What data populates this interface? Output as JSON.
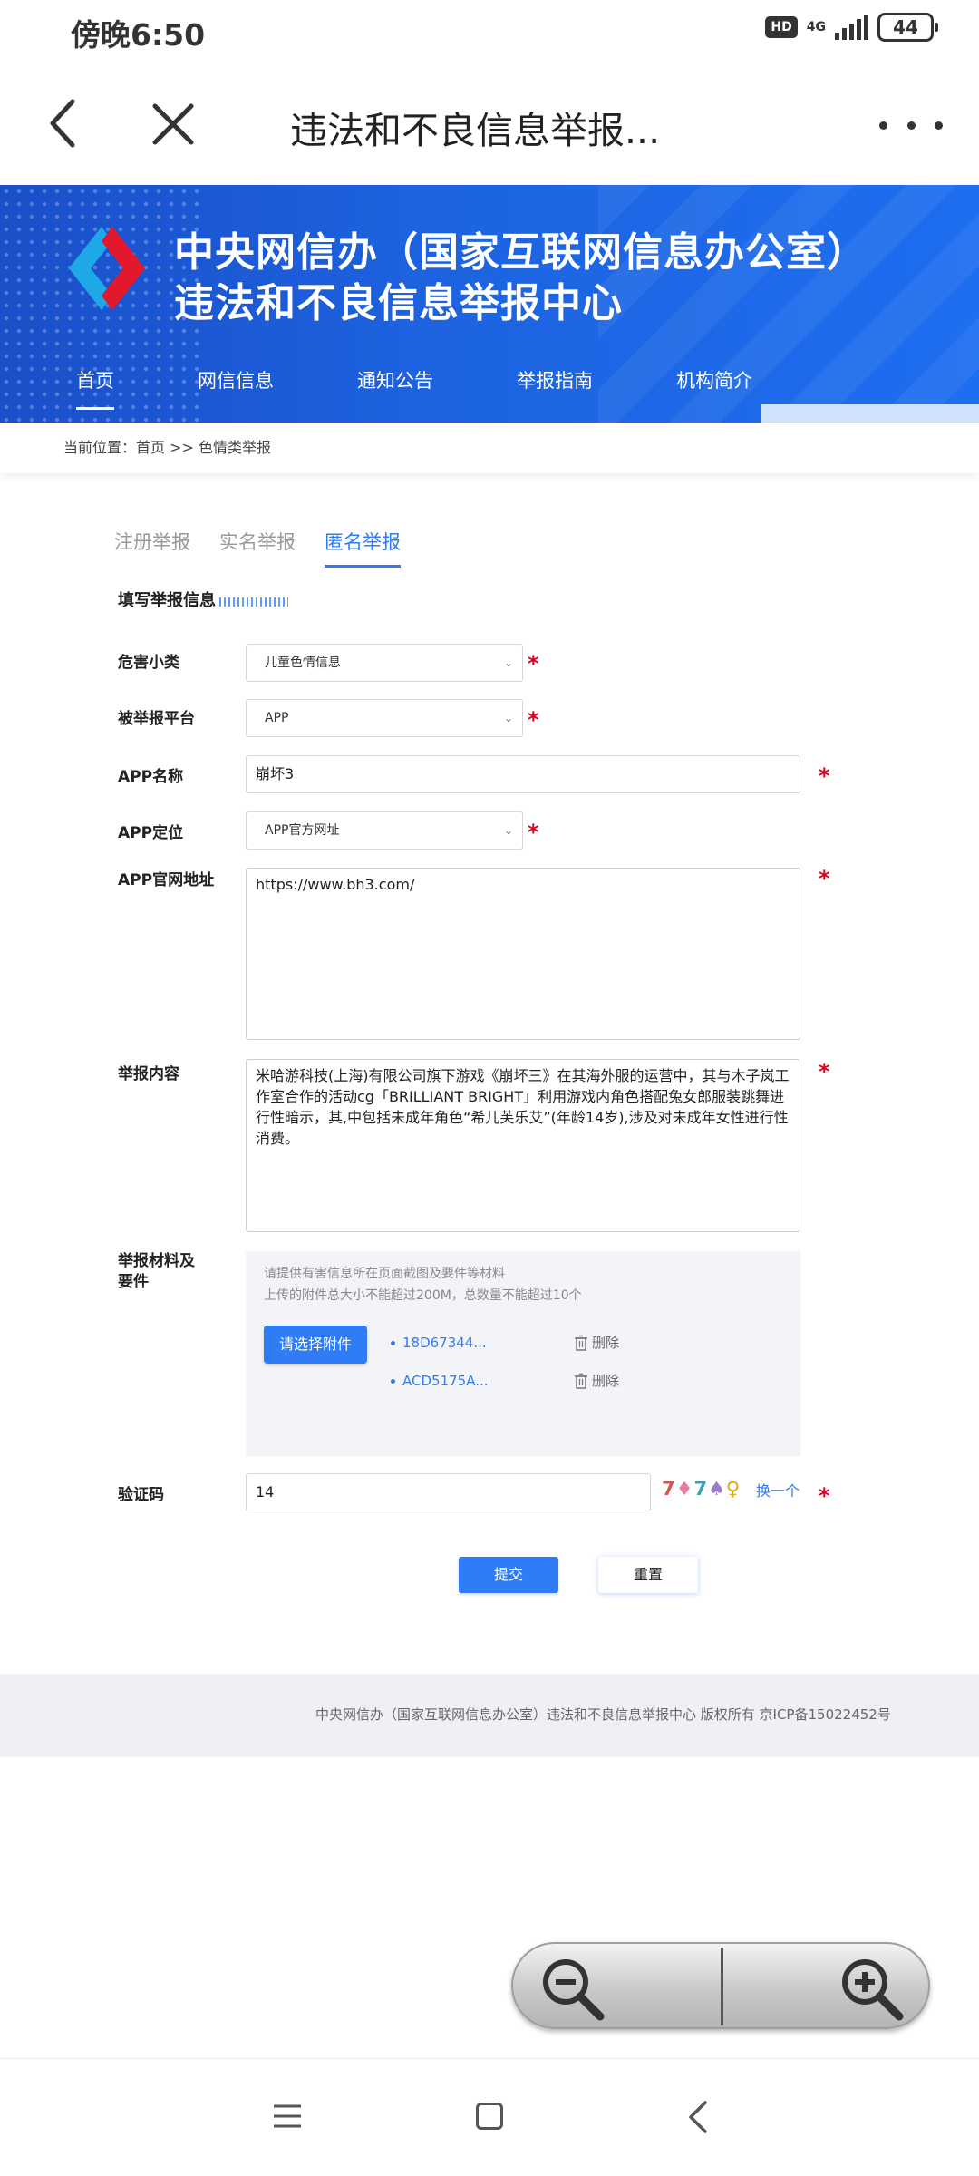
{
  "status": {
    "time": "傍晚6:50",
    "hd": "HD",
    "network": "4G",
    "battery": "44"
  },
  "header": {
    "title": "违法和不良信息举报..."
  },
  "banner": {
    "title_line1": "中央网信办（国家互联网信息办公室）",
    "title_line2": "违法和不良信息举报中心",
    "nav": [
      "首页",
      "网信信息",
      "通知公告",
      "举报指南",
      "机构简介"
    ],
    "active_nav": "首页"
  },
  "breadcrumb": "当前位置：首页 >> 色情类举报",
  "tabs": {
    "items": [
      "注册举报",
      "实名举报",
      "匿名举报"
    ],
    "active": "匿名举报"
  },
  "form": {
    "section_title": "填写举报信息",
    "required_mark": "*",
    "harm_type": {
      "label": "危害小类",
      "value": "儿童色情信息"
    },
    "platform": {
      "label": "被举报平台",
      "value": "APP"
    },
    "app_name": {
      "label": "APP名称",
      "value": "崩坏3"
    },
    "app_position": {
      "label": "APP定位",
      "value": "APP官方网址"
    },
    "app_url": {
      "label": "APP官网地址",
      "value": "https://www.bh3.com/"
    },
    "content": {
      "label": "举报内容",
      "value": "米哈游科技(上海)有限公司旗下游戏《崩坏三》在其海外服的运营中，其与木子岚工作室合作的活动cg「BRILLIANT BRIGHT」利用游戏内角色搭配兔女郎服装跳舞进行性暗示，其,中包括未成年角色“希儿芙乐艾”(年龄14岁),涉及对未成年女性进行性消费。"
    },
    "attachments": {
      "label": "举报材料及要件",
      "hint1": "请提供有害信息所在页面截图及要件等材料",
      "hint2": "上传的附件总大小不能超过200M，总数量不能超过10个",
      "button": "请选择附件",
      "files": [
        {
          "name": "18D67344...",
          "delete": "删除"
        },
        {
          "name": "ACD5175A...",
          "delete": "删除"
        }
      ]
    },
    "captcha": {
      "label": "验证码",
      "value": "14",
      "image_text": "7♦7♠♀",
      "refresh": "换一个"
    },
    "submit": "提交",
    "reset": "重置"
  },
  "footer": "中央网信办（国家互联网信息办公室）违法和不良信息举报中心 版权所有 京ICP备15022452号",
  "colors": {
    "accent": "#2f7cf6",
    "banner": "#1d63e0",
    "required": "#e0001b"
  }
}
